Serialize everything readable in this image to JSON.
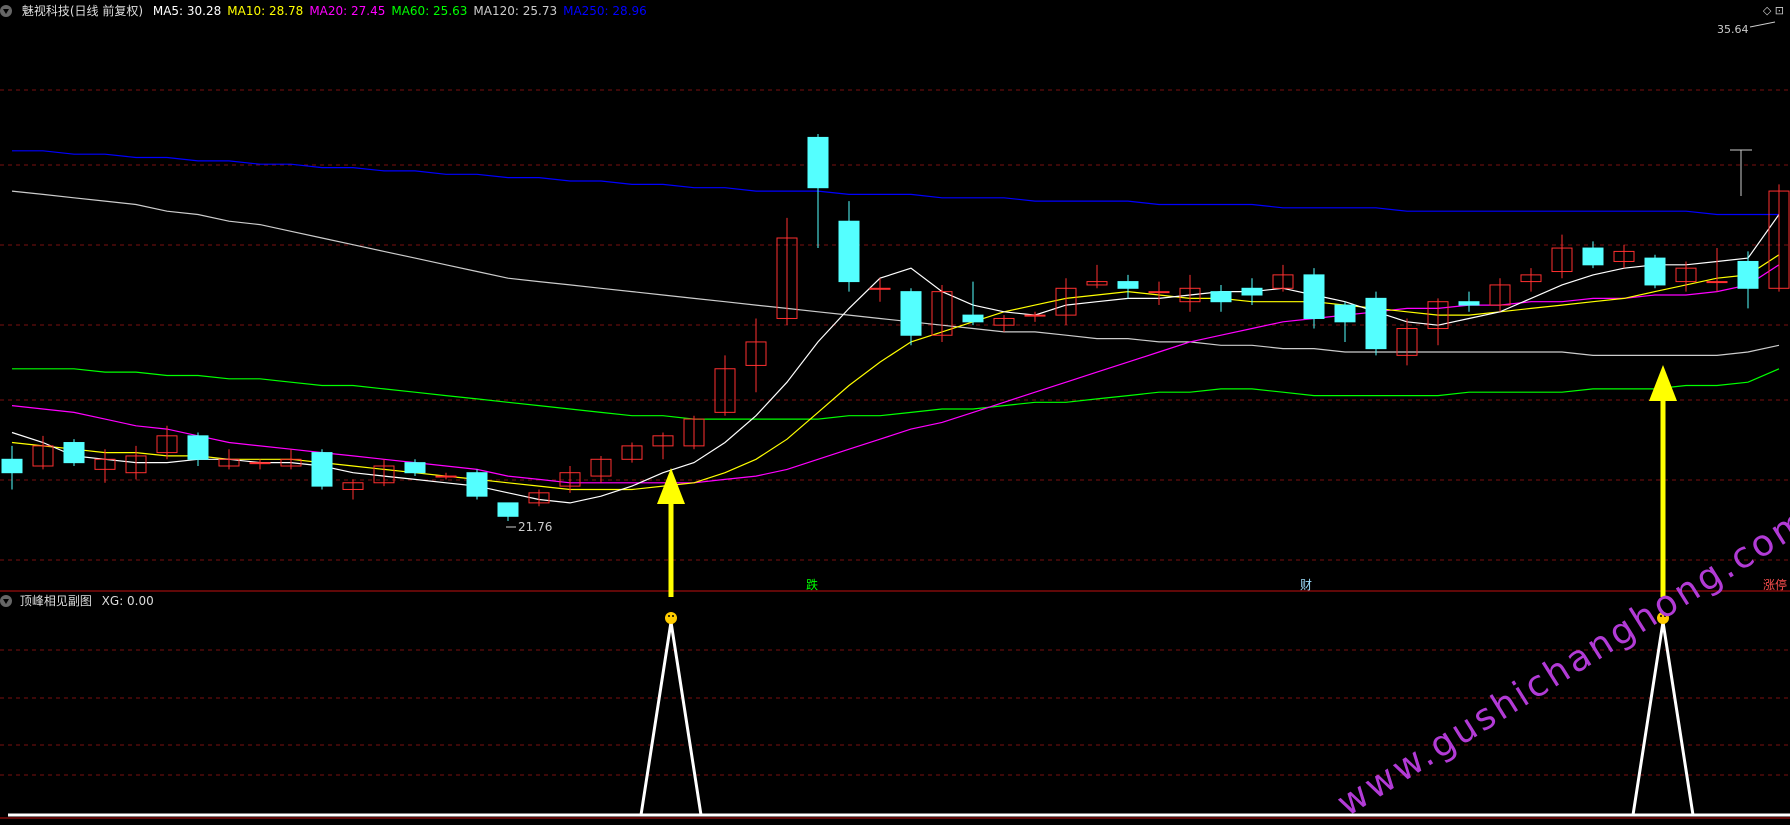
{
  "header": {
    "stock": "魅视科技(日线 前复权)",
    "ma": [
      {
        "label": "MA5: 30.28",
        "color": "#ffffff"
      },
      {
        "label": "MA10: 28.78",
        "color": "#ffff00"
      },
      {
        "label": "MA20: 27.45",
        "color": "#ff00ff"
      },
      {
        "label": "MA60: 25.63",
        "color": "#00ff00"
      },
      {
        "label": "MA120: 25.73",
        "color": "#cccccc"
      },
      {
        "label": "MA250: 28.96",
        "color": "#0000ff"
      }
    ]
  },
  "sub_header": {
    "title": "顶峰相见副图",
    "xg": "XG: 0.00"
  },
  "corner_icons": "◇ ⊡",
  "markers": {
    "die": "跌",
    "cai": "财",
    "zhangting": "涨停"
  },
  "watermark": "www.gushichanghong.com",
  "colors": {
    "up": "#ff3030",
    "down": "#54ffff",
    "ma5": "#ffffff",
    "ma10": "#ffff00",
    "ma20": "#ff00ff",
    "ma60": "#00ff00",
    "ma120": "#cccccc",
    "ma250": "#0000ff",
    "arrow": "#ffff00"
  },
  "chart_data": {
    "type": "candlestick",
    "y_range": [
      20.0,
      37.0
    ],
    "high_label": "35.64",
    "low_label": "21.76",
    "candles": [
      [
        23.6,
        23.2,
        24.0,
        22.7
      ],
      [
        23.4,
        24.0,
        24.3,
        23.3
      ],
      [
        24.1,
        23.5,
        24.2,
        23.4
      ],
      [
        23.3,
        23.6,
        23.9,
        22.9
      ],
      [
        23.2,
        23.7,
        24.0,
        23.0
      ],
      [
        23.8,
        24.3,
        24.6,
        23.6
      ],
      [
        24.3,
        23.6,
        24.4,
        23.4
      ],
      [
        23.4,
        23.6,
        23.9,
        23.3
      ],
      [
        23.5,
        23.5,
        23.6,
        23.3
      ],
      [
        23.4,
        23.6,
        23.9,
        23.3
      ],
      [
        23.8,
        22.8,
        23.9,
        22.7
      ],
      [
        22.7,
        22.9,
        23.0,
        22.4
      ],
      [
        22.9,
        23.4,
        23.6,
        22.8
      ],
      [
        23.5,
        23.2,
        23.6,
        23.1
      ],
      [
        23.1,
        23.1,
        23.2,
        23.0
      ],
      [
        23.2,
        22.5,
        23.3,
        22.4
      ],
      [
        22.3,
        21.9,
        22.3,
        21.76
      ],
      [
        22.3,
        22.6,
        22.7,
        22.2
      ],
      [
        22.8,
        23.2,
        23.4,
        22.6
      ],
      [
        23.1,
        23.6,
        23.7,
        22.9
      ],
      [
        23.6,
        24.0,
        24.1,
        23.5
      ],
      [
        24.0,
        24.3,
        24.4,
        23.6
      ],
      [
        24.0,
        24.8,
        24.9,
        23.9
      ],
      [
        25.0,
        26.3,
        26.7,
        24.9
      ],
      [
        26.4,
        27.1,
        27.8,
        25.6
      ],
      [
        27.8,
        30.2,
        30.8,
        27.6
      ],
      [
        33.2,
        31.7,
        33.3,
        29.9
      ],
      [
        30.7,
        28.9,
        31.3,
        28.6
      ],
      [
        28.7,
        28.7,
        29.0,
        28.3
      ],
      [
        28.6,
        27.3,
        28.7,
        27.0
      ],
      [
        27.3,
        28.6,
        28.8,
        27.1
      ],
      [
        27.9,
        27.7,
        28.9,
        27.6
      ],
      [
        27.6,
        27.8,
        27.9,
        27.4
      ],
      [
        27.9,
        27.9,
        28.0,
        27.7
      ],
      [
        27.9,
        28.7,
        29.0,
        27.6
      ],
      [
        28.8,
        28.9,
        29.4,
        28.7
      ],
      [
        28.9,
        28.7,
        29.1,
        28.4
      ],
      [
        28.6,
        28.6,
        28.9,
        28.2
      ],
      [
        28.3,
        28.7,
        29.1,
        28.0
      ],
      [
        28.6,
        28.3,
        28.8,
        28.0
      ],
      [
        28.7,
        28.5,
        29.0,
        28.2
      ],
      [
        28.7,
        29.1,
        29.4,
        28.6
      ],
      [
        29.1,
        27.8,
        29.3,
        27.5
      ],
      [
        28.2,
        27.7,
        28.3,
        27.1
      ],
      [
        28.4,
        26.9,
        28.6,
        26.7
      ],
      [
        26.7,
        27.5,
        27.8,
        26.4
      ],
      [
        27.5,
        28.3,
        28.4,
        27.0
      ],
      [
        28.3,
        28.2,
        28.6,
        28.0
      ],
      [
        28.2,
        28.8,
        29.0,
        28.0
      ],
      [
        28.9,
        29.1,
        29.3,
        28.6
      ],
      [
        29.2,
        29.9,
        30.3,
        29.0
      ],
      [
        29.9,
        29.4,
        30.1,
        29.3
      ],
      [
        29.5,
        29.8,
        30.0,
        29.3
      ],
      [
        29.6,
        28.8,
        29.7,
        28.7
      ],
      [
        28.9,
        29.3,
        29.5,
        28.6
      ],
      [
        28.9,
        28.9,
        29.9,
        28.6
      ],
      [
        29.5,
        28.7,
        29.8,
        28.1
      ],
      [
        28.7,
        31.6,
        31.8,
        28.6
      ]
    ],
    "ma5": [
      24.4,
      24.1,
      23.7,
      23.6,
      23.5,
      23.5,
      23.6,
      23.6,
      23.5,
      23.5,
      23.4,
      23.2,
      23.1,
      23.0,
      22.9,
      22.8,
      22.6,
      22.4,
      22.3,
      22.5,
      22.8,
      23.2,
      23.5,
      24.1,
      24.9,
      25.9,
      27.1,
      28.1,
      29.0,
      29.3,
      28.6,
      28.2,
      28.0,
      27.9,
      28.2,
      28.3,
      28.4,
      28.4,
      28.5,
      28.6,
      28.6,
      28.7,
      28.5,
      28.3,
      28.0,
      27.7,
      27.6,
      27.8,
      28.0,
      28.4,
      28.8,
      29.1,
      29.3,
      29.4,
      29.4,
      29.5,
      29.6,
      30.9
    ],
    "ma10": [
      24.1,
      24.0,
      23.9,
      23.8,
      23.8,
      23.7,
      23.7,
      23.6,
      23.6,
      23.6,
      23.5,
      23.4,
      23.3,
      23.2,
      23.1,
      23.0,
      22.9,
      22.8,
      22.7,
      22.7,
      22.7,
      22.8,
      22.9,
      23.2,
      23.6,
      24.2,
      25.0,
      25.8,
      26.5,
      27.1,
      27.4,
      27.7,
      28.0,
      28.2,
      28.4,
      28.5,
      28.6,
      28.5,
      28.4,
      28.4,
      28.3,
      28.3,
      28.3,
      28.2,
      28.1,
      28.0,
      27.9,
      27.9,
      28.0,
      28.1,
      28.2,
      28.3,
      28.4,
      28.6,
      28.8,
      29.0,
      29.1,
      29.7
    ],
    "ma20": [
      25.2,
      25.1,
      25.0,
      24.8,
      24.6,
      24.5,
      24.3,
      24.1,
      24.0,
      23.9,
      23.8,
      23.7,
      23.6,
      23.5,
      23.4,
      23.3,
      23.1,
      23.0,
      22.9,
      22.9,
      22.9,
      22.9,
      22.9,
      23.0,
      23.1,
      23.3,
      23.6,
      23.9,
      24.2,
      24.5,
      24.7,
      25.0,
      25.3,
      25.6,
      25.9,
      26.2,
      26.5,
      26.8,
      27.1,
      27.3,
      27.5,
      27.7,
      27.8,
      27.9,
      28.0,
      28.1,
      28.1,
      28.2,
      28.2,
      28.3,
      28.3,
      28.4,
      28.4,
      28.5,
      28.5,
      28.6,
      28.8,
      29.4
    ],
    "ma60": [
      26.3,
      26.3,
      26.3,
      26.2,
      26.2,
      26.1,
      26.1,
      26.0,
      26.0,
      25.9,
      25.8,
      25.8,
      25.7,
      25.6,
      25.5,
      25.4,
      25.3,
      25.2,
      25.1,
      25.0,
      24.9,
      24.9,
      24.8,
      24.8,
      24.8,
      24.8,
      24.8,
      24.9,
      24.9,
      25.0,
      25.1,
      25.1,
      25.2,
      25.3,
      25.3,
      25.4,
      25.5,
      25.6,
      25.6,
      25.7,
      25.7,
      25.6,
      25.5,
      25.5,
      25.5,
      25.5,
      25.5,
      25.6,
      25.6,
      25.6,
      25.6,
      25.7,
      25.7,
      25.7,
      25.8,
      25.8,
      25.9,
      26.3
    ],
    "ma120": [
      31.6,
      31.5,
      31.4,
      31.3,
      31.2,
      31.0,
      30.9,
      30.7,
      30.6,
      30.4,
      30.2,
      30.0,
      29.8,
      29.6,
      29.4,
      29.2,
      29.0,
      28.9,
      28.8,
      28.7,
      28.6,
      28.5,
      28.4,
      28.3,
      28.2,
      28.1,
      28.0,
      27.9,
      27.8,
      27.7,
      27.6,
      27.5,
      27.4,
      27.4,
      27.3,
      27.2,
      27.2,
      27.1,
      27.1,
      27.0,
      27.0,
      26.9,
      26.9,
      26.8,
      26.8,
      26.8,
      26.8,
      26.8,
      26.8,
      26.8,
      26.8,
      26.7,
      26.7,
      26.7,
      26.7,
      26.7,
      26.8,
      27.0
    ],
    "ma250": [
      32.8,
      32.8,
      32.7,
      32.7,
      32.6,
      32.6,
      32.5,
      32.5,
      32.4,
      32.4,
      32.3,
      32.3,
      32.2,
      32.2,
      32.1,
      32.1,
      32.0,
      32.0,
      31.9,
      31.9,
      31.8,
      31.8,
      31.7,
      31.7,
      31.6,
      31.6,
      31.6,
      31.5,
      31.5,
      31.5,
      31.4,
      31.4,
      31.4,
      31.3,
      31.3,
      31.3,
      31.3,
      31.2,
      31.2,
      31.2,
      31.2,
      31.1,
      31.1,
      31.1,
      31.1,
      31.0,
      31.0,
      31.0,
      31.0,
      31.0,
      31.0,
      31.0,
      31.0,
      31.0,
      31.0,
      30.9,
      30.9,
      30.9
    ],
    "signal_bars": [
      21,
      53
    ]
  }
}
